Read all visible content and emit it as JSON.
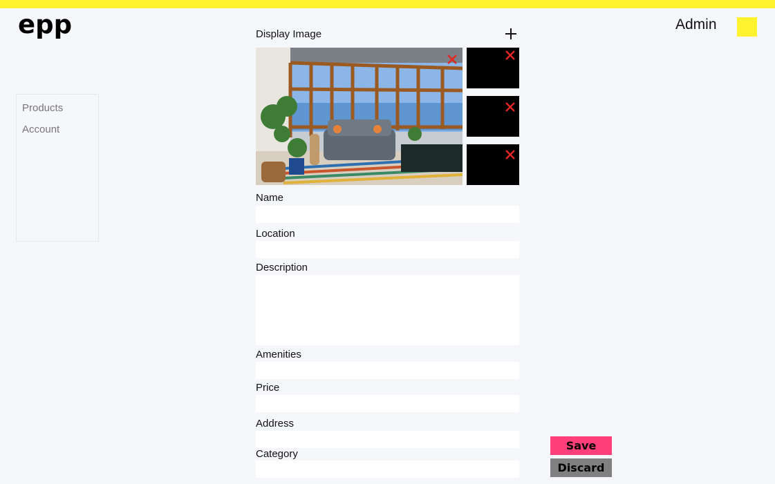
{
  "brand": {
    "logo_text": "epp",
    "accent": "#fff330"
  },
  "header": {
    "user_label": "Admin"
  },
  "sidebar": {
    "items": [
      {
        "label": "Products"
      },
      {
        "label": "Account"
      }
    ]
  },
  "form": {
    "display_image_label": "Display Image",
    "name_label": "Name",
    "location_label": "Location",
    "description_label": "Description",
    "amenities_label": "Amenities",
    "price_label": "Price",
    "address_label": "Address",
    "category_label": "Category",
    "name_value": "",
    "location_value": "",
    "description_value": "",
    "amenities_value": "",
    "price_value": "",
    "address_value": "",
    "category_value": ""
  },
  "images": {
    "main": {
      "subject": "sunroom-living-room-photo"
    },
    "thumbnails_count": 3,
    "remove_icon_color": "#e5261e"
  },
  "actions": {
    "save_label": "Save",
    "discard_label": "Discard",
    "save_color": "#ff3f7a",
    "discard_color": "#808080"
  }
}
